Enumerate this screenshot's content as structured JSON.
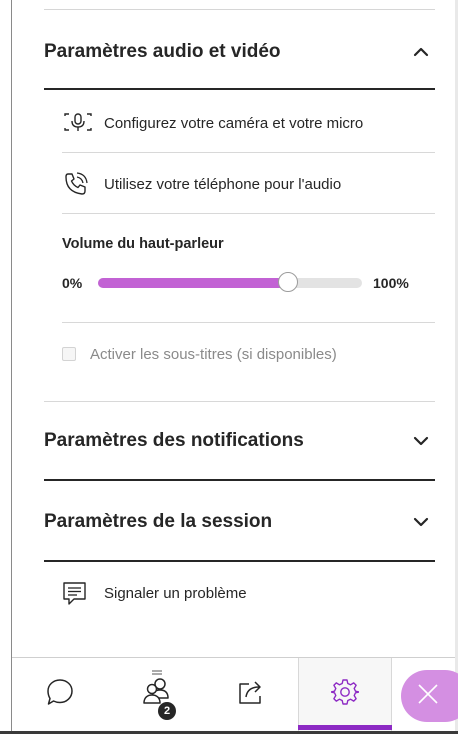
{
  "audio_video": {
    "title": "Paramètres audio et vidéo",
    "expanded": true,
    "camera_mic_label": "Configurez votre caméra et votre micro",
    "phone_audio_label": "Utilisez votre téléphone pour l'audio",
    "speaker_volume": {
      "label": "Volume du haut-parleur",
      "min_label": "0%",
      "max_label": "100%",
      "value_percent": 72
    },
    "captions": {
      "label": "Activer les sous-titres (si disponibles)",
      "checked": false,
      "enabled": false
    }
  },
  "notifications": {
    "title": "Paramètres des notifications",
    "expanded": false
  },
  "session": {
    "title": "Paramètres de la session",
    "expanded": false
  },
  "report_problem_label": "Signaler un problème",
  "tabbar": {
    "tabs": [
      {
        "name": "chat",
        "icon": "chat-bubble-icon"
      },
      {
        "name": "participants",
        "icon": "participants-icon",
        "badge": "2"
      },
      {
        "name": "share-content",
        "icon": "share-content-icon"
      },
      {
        "name": "settings",
        "icon": "gear-icon",
        "active": true
      }
    ],
    "close_icon": "close-icon"
  },
  "colors": {
    "accent": "#8d2ac4",
    "slider_fill": "#c262d4",
    "close_button": "#d48fe2",
    "text": "#262626",
    "muted": "#8a8a8a"
  }
}
